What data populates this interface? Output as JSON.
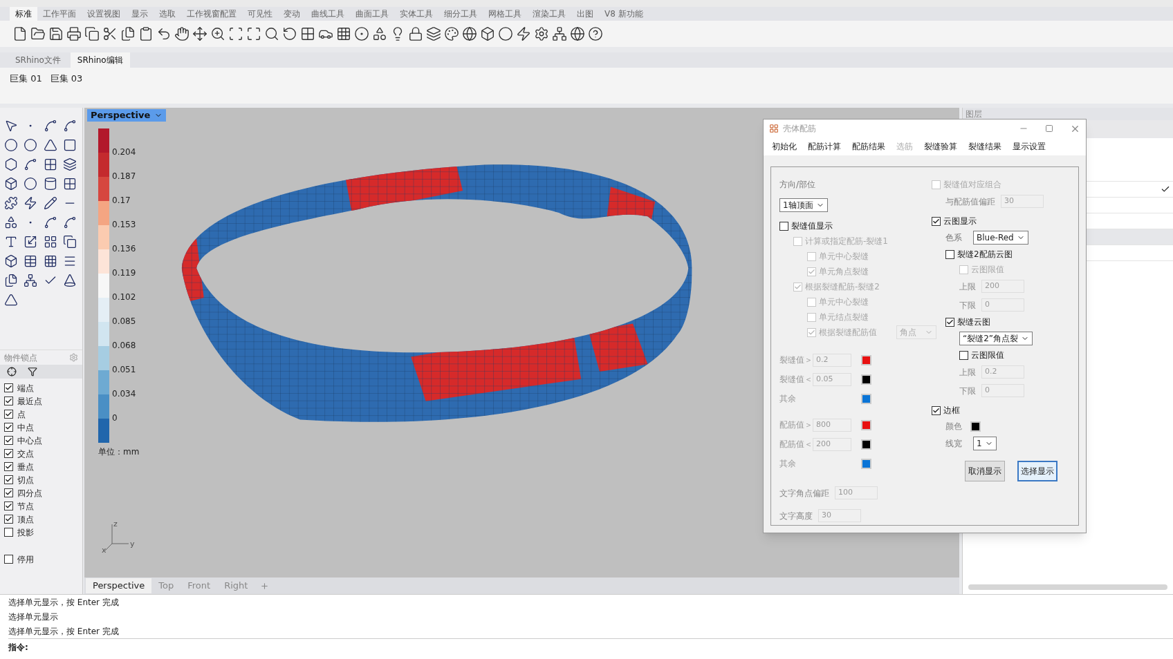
{
  "menu_tabs": [
    {
      "label": "标准",
      "selected": true
    },
    {
      "label": "工作平面",
      "selected": false
    },
    {
      "label": "设置视图",
      "selected": false
    },
    {
      "label": "显示",
      "selected": false
    },
    {
      "label": "选取",
      "selected": false
    },
    {
      "label": "工作视窗配置",
      "selected": false
    },
    {
      "label": "可见性",
      "selected": false
    },
    {
      "label": "变动",
      "selected": false
    },
    {
      "label": "曲线工具",
      "selected": false
    },
    {
      "label": "曲面工具",
      "selected": false
    },
    {
      "label": "实体工具",
      "selected": false
    },
    {
      "label": "细分工具",
      "selected": false
    },
    {
      "label": "网格工具",
      "selected": false
    },
    {
      "label": "渲染工具",
      "selected": false
    },
    {
      "label": "出图",
      "selected": false
    },
    {
      "label": "V8 新功能",
      "selected": false
    }
  ],
  "plugin_tabs": [
    {
      "label": "SRhino文件",
      "selected": false
    },
    {
      "label": "SRhino编辑",
      "selected": true
    }
  ],
  "macros": [
    "巨集 01",
    "巨集 03"
  ],
  "osnap": {
    "title": "物件锁点",
    "items": [
      {
        "label": "端点",
        "checked": true
      },
      {
        "label": "最近点",
        "checked": true
      },
      {
        "label": "点",
        "checked": true
      },
      {
        "label": "中点",
        "checked": true
      },
      {
        "label": "中心点",
        "checked": true
      },
      {
        "label": "交点",
        "checked": true
      },
      {
        "label": "垂点",
        "checked": true
      },
      {
        "label": "切点",
        "checked": true
      },
      {
        "label": "四分点",
        "checked": true
      },
      {
        "label": "节点",
        "checked": true
      },
      {
        "label": "顶点",
        "checked": true
      },
      {
        "label": "投影",
        "checked": false
      }
    ],
    "disable": {
      "label": "停用",
      "checked": false
    }
  },
  "viewport": {
    "title": "Perspective",
    "legend": {
      "segments": [
        {
          "color": "#b2182b",
          "label": "0.204"
        },
        {
          "color": "#c42a2e",
          "label": "0.187"
        },
        {
          "color": "#d6473f",
          "label": "0.17"
        },
        {
          "color": "#f4a582",
          "label": "0.153"
        },
        {
          "color": "#fbcbb0",
          "label": "0.136"
        },
        {
          "color": "#fde4d8",
          "label": "0.119"
        },
        {
          "color": "#f7f7f7",
          "label": "0.102"
        },
        {
          "color": "#e4eef5",
          "label": "0.085"
        },
        {
          "color": "#d1e5f0",
          "label": "0.068"
        },
        {
          "color": "#a6cde2",
          "label": "0.051"
        },
        {
          "color": "#6eaad2",
          "label": "0.034"
        },
        {
          "color": "#4a8fc5",
          "label": "0"
        },
        {
          "color": "#2166ac"
        }
      ],
      "unit": "单位：mm"
    },
    "axes": [
      "z",
      "y",
      "x"
    ]
  },
  "viewport_tabs": [
    {
      "label": "Perspective",
      "selected": true
    },
    {
      "label": "Top",
      "selected": false
    },
    {
      "label": "Front",
      "selected": false
    },
    {
      "label": "Right",
      "selected": false
    }
  ],
  "layers_panel": {
    "title": "图层",
    "rows": [
      {
        "checked": false,
        "selected": false
      },
      {
        "checked": true,
        "selected": false
      },
      {
        "checked": false,
        "selected": false
      },
      {
        "checked": false,
        "selected": false
      },
      {
        "checked": false,
        "selected": true
      },
      {
        "checked": false,
        "selected": false
      }
    ]
  },
  "dialog": {
    "title": "壳体配筋",
    "tabs": [
      {
        "label": "初始化",
        "disabled": false
      },
      {
        "label": "配筋计算",
        "disabled": false
      },
      {
        "label": "配筋结果",
        "disabled": false
      },
      {
        "label": "选筋",
        "disabled": true
      },
      {
        "label": "裂缝验算",
        "disabled": false
      },
      {
        "label": "裂缝结果",
        "disabled": false
      },
      {
        "label": "显示设置",
        "disabled": false
      }
    ],
    "left": [
      {
        "kind": "label",
        "label": "方向/部位"
      },
      {
        "kind": "select",
        "value": "1轴顶面",
        "disabled": false
      },
      {
        "kind": "checkbox",
        "label": "裂缝值显示",
        "checked": false,
        "disabled": false,
        "children": [
          {
            "kind": "checkbox",
            "label": "计算或指定配筋-裂缝1",
            "checked": false,
            "disabled": true,
            "children": [
              {
                "kind": "checkbox",
                "label": "单元中心裂缝",
                "checked": false,
                "disabled": true
              },
              {
                "kind": "checkbox",
                "label": "单元角点裂缝",
                "checked": true,
                "disabled": true
              }
            ]
          },
          {
            "kind": "checkbox",
            "label": "根据裂缝配筋-裂缝2",
            "checked": true,
            "disabled": true,
            "children": [
              {
                "kind": "checkbox",
                "label": "单元中心裂缝",
                "checked": false,
                "disabled": true
              },
              {
                "kind": "checkbox",
                "label": "单元结点裂缝",
                "checked": false,
                "disabled": true
              },
              {
                "kind": "checkbox",
                "label": "根据裂缝配筋值",
                "checked": true,
                "disabled": true,
                "select": "角点"
              }
            ]
          }
        ]
      },
      {
        "kind": "threshold",
        "label": "裂缝值＞",
        "value": "0.2",
        "color": "#e81010",
        "disabled": true
      },
      {
        "kind": "threshold",
        "label": "裂缝值＜",
        "value": "0.05",
        "color": "#000000",
        "disabled": true
      },
      {
        "kind": "threshold",
        "label": "其余",
        "color": "#0a74d6",
        "disabled": true
      },
      {
        "kind": "threshold",
        "label": "配筋值＞",
        "value": "800",
        "color": "#e81010",
        "disabled": true
      },
      {
        "kind": "threshold",
        "label": "配筋值＜",
        "value": "200",
        "color": "#000000",
        "disabled": true
      },
      {
        "kind": "threshold",
        "label": "其余",
        "color": "#0a74d6",
        "disabled": true
      },
      {
        "kind": "field",
        "label": "文字角点偏距",
        "value": "100",
        "disabled": true
      },
      {
        "kind": "field",
        "label": "文字高度",
        "value": "30",
        "disabled": true
      }
    ],
    "right": [
      {
        "kind": "checkbox",
        "label": "裂缝值对应组合",
        "checked": false,
        "disabled": true,
        "children": [
          {
            "kind": "field",
            "label": "与配筋值偏距",
            "value": "30",
            "disabled": true
          }
        ]
      },
      {
        "kind": "checkbox",
        "label": "云图显示",
        "checked": true,
        "disabled": false,
        "children": [
          {
            "kind": "select",
            "label": "色系",
            "value": "Blue-Red",
            "disabled": false
          },
          {
            "kind": "checkbox",
            "label": "裂缝2配筋云图",
            "checked": false,
            "disabled": false,
            "children": [
              {
                "kind": "checkbox",
                "label": "云图限值",
                "checked": false,
                "disabled": true
              },
              {
                "kind": "field",
                "label": "上限",
                "value": "200",
                "disabled": true
              },
              {
                "kind": "field",
                "label": "下限",
                "value": "0",
                "disabled": true
              }
            ]
          },
          {
            "kind": "checkbox",
            "label": "裂缝云图",
            "checked": true,
            "disabled": false,
            "children": [
              {
                "kind": "select",
                "value": "“裂缝2”角点裂",
                "disabled": false
              },
              {
                "kind": "checkbox",
                "label": "云图限值",
                "checked": false,
                "disabled": false
              },
              {
                "kind": "field",
                "label": "上限",
                "value": "0.2",
                "disabled": true
              },
              {
                "kind": "field",
                "label": "下限",
                "value": "0",
                "disabled": true
              }
            ]
          }
        ]
      },
      {
        "kind": "checkbox",
        "label": "边框",
        "checked": true,
        "disabled": false,
        "children": [
          {
            "kind": "color",
            "label": "颜色",
            "color": "#000000"
          },
          {
            "kind": "select",
            "label": "线宽",
            "value": "1",
            "disabled": false
          }
        ]
      }
    ],
    "buttons": [
      {
        "label": "取消显示",
        "selected": false
      },
      {
        "label": "选择显示",
        "selected": true
      }
    ]
  },
  "command_history": [
    "选择单元显示，按 Enter 完成",
    "选择单元显示",
    "选择单元显示，按 Enter 完成"
  ],
  "command_prompt": "指令:"
}
